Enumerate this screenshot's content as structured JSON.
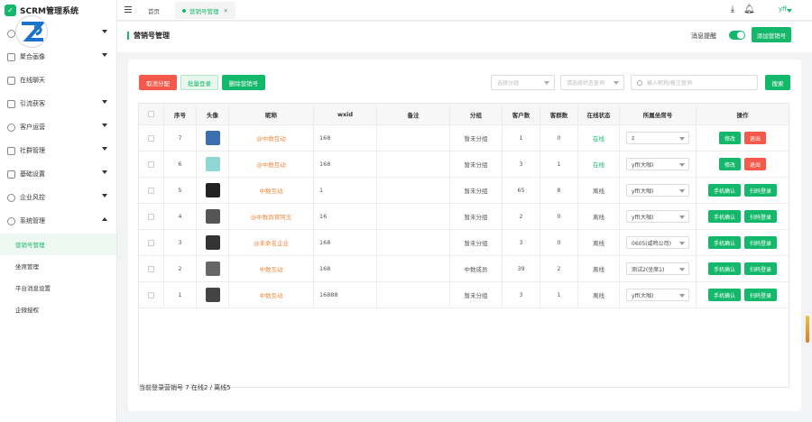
{
  "app": {
    "title": "SCRM管理系统"
  },
  "sidebar": {
    "items": [
      {
        "label": "聚合画像",
        "expanded": false
      },
      {
        "label": "在线聊天",
        "expanded": false
      },
      {
        "label": "引流获客",
        "expanded": false
      },
      {
        "label": "客户运营",
        "expanded": false
      },
      {
        "label": "社群管理",
        "expanded": false
      },
      {
        "label": "基础设置",
        "expanded": false
      },
      {
        "label": "企业风控",
        "expanded": false
      },
      {
        "label": "系统管理",
        "expanded": true
      }
    ],
    "sub_items": [
      {
        "label": "营销号管理",
        "active": true
      },
      {
        "label": "坐席管理",
        "active": false
      },
      {
        "label": "平台消息设置",
        "active": false
      },
      {
        "label": "企微授权",
        "active": false
      }
    ]
  },
  "topbar": {
    "tabs": [
      {
        "label": "首页"
      },
      {
        "label": "营销号管理"
      }
    ],
    "user": "yff"
  },
  "page": {
    "title": "营销号管理",
    "msg_label": "消息提醒",
    "msg_enabled": true,
    "add_button": "添加营销号"
  },
  "toolbar": {
    "cancel_assign": "取消分配",
    "batch_login": "批量登录",
    "delete": "删除营销号",
    "group_placeholder": "选择分组",
    "status_placeholder": "请选择状态查询",
    "search_placeholder": "输入昵称/备注查询",
    "search_button": "搜索"
  },
  "table": {
    "columns": [
      "",
      "序号",
      "头像",
      "昵称",
      "wxid",
      "备注",
      "分组",
      "客户数",
      "客群数",
      "在线状态",
      "所属坐席号",
      "操作"
    ],
    "rows": [
      {
        "no": "7",
        "nickname": "@中数互动",
        "wxid": "168",
        "group": "暂未分组",
        "customers": "1",
        "groups": "0",
        "status": "在线",
        "seat": "z",
        "actions": [
          "修改",
          "退出"
        ],
        "avatar_color": "#3d6fb0"
      },
      {
        "no": "6",
        "nickname": "@中数互动",
        "wxid": "168",
        "group": "暂未分组",
        "customers": "3",
        "groups": "1",
        "status": "在线",
        "seat": "yff(大咖)",
        "actions": [
          "修改",
          "退出"
        ],
        "avatar_color": "#8fd6d4"
      },
      {
        "no": "5",
        "nickname": "中数互动",
        "wxid": "1",
        "group": "暂未分组",
        "customers": "65",
        "groups": "8",
        "status": "离线",
        "seat": "yff(大咖)",
        "actions": [
          "手机确认",
          "扫码登录"
        ],
        "avatar_color": "#222222"
      },
      {
        "no": "4",
        "nickname": "@中数尚宵阿玉",
        "wxid": "16",
        "group": "暂未分组",
        "customers": "2",
        "groups": "0",
        "status": "离线",
        "seat": "yff(大咖)",
        "actions": [
          "手机确认",
          "扫码登录"
        ],
        "avatar_color": "#555555"
      },
      {
        "no": "3",
        "nickname": "@未命名企业",
        "wxid": "168",
        "group": "暂未分组",
        "customers": "3",
        "groups": "0",
        "status": "离线",
        "seat": "0605(咸鸣公司)",
        "actions": [
          "手机确认",
          "扫码登录"
        ],
        "avatar_color": "#333333"
      },
      {
        "no": "2",
        "nickname": "中数互动",
        "wxid": "168",
        "group": "中数成员",
        "customers": "39",
        "groups": "2",
        "status": "离线",
        "seat": "测试2(坐席1)",
        "actions": [
          "手机确认",
          "扫码登录"
        ],
        "avatar_color": "#666666"
      },
      {
        "no": "1",
        "nickname": "中数互动",
        "wxid": "16888",
        "group": "暂未分组",
        "customers": "3",
        "groups": "1",
        "status": "离线",
        "seat": "yff(大咖)",
        "actions": [
          "手机确认",
          "扫码登录"
        ],
        "avatar_color": "#444444"
      }
    ]
  },
  "summary": "当前登录营销号 7 在线2 / 离线5",
  "colors": {
    "accent": "#14b86a",
    "danger": "#f35a4c",
    "nickname": "#f0883c"
  }
}
